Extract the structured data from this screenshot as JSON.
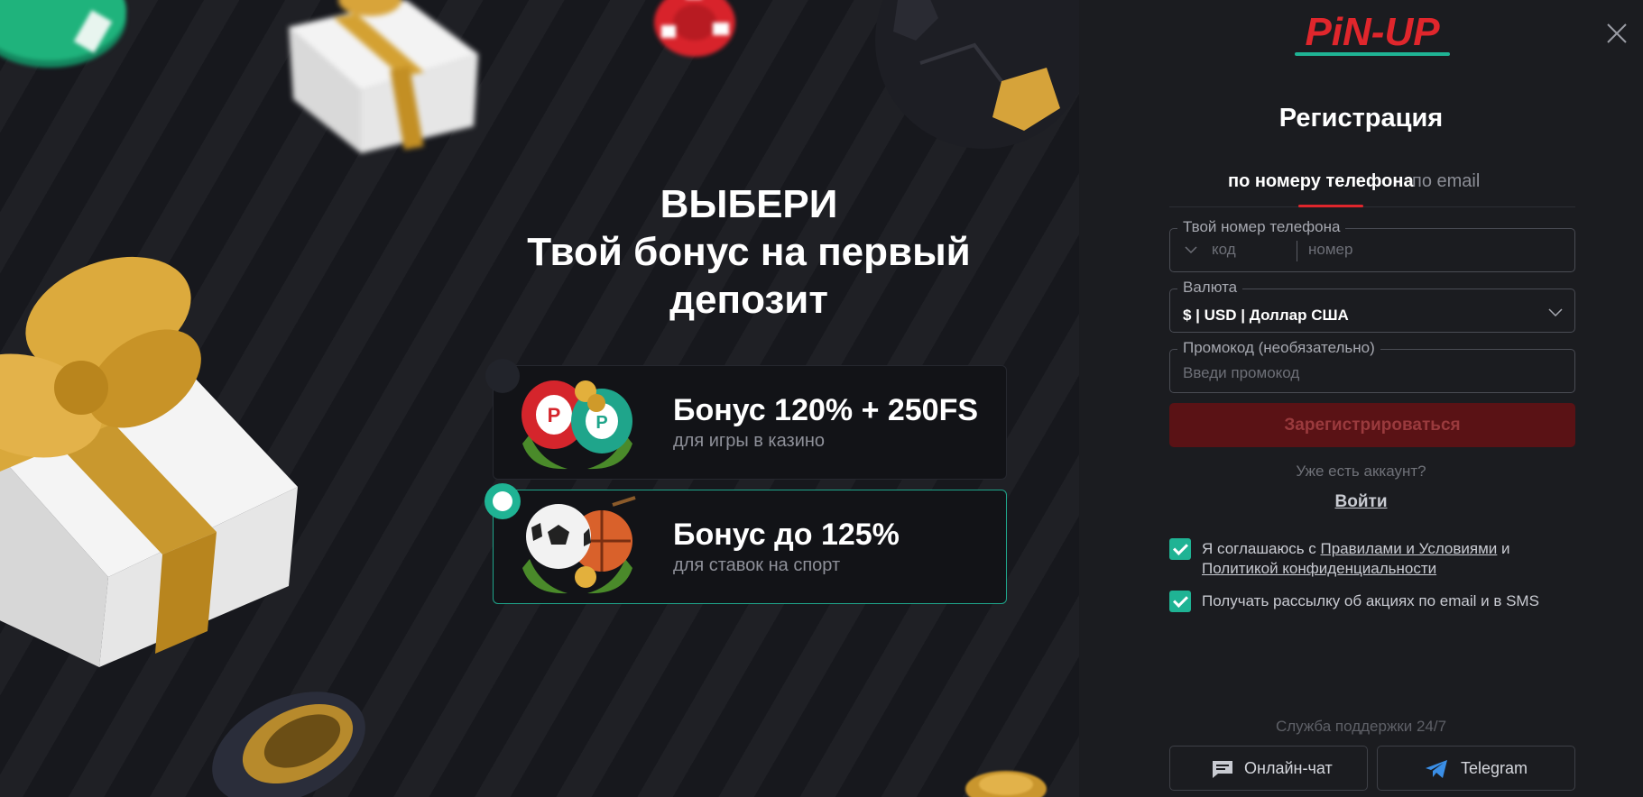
{
  "promo": {
    "title_line1": "ВЫБЕРИ",
    "title_line2": "Твой бонус на первый",
    "title_line3": "депозит",
    "bonuses": [
      {
        "title": "Бонус 120% + 250FS",
        "subtitle": "для игры в казино",
        "selected": false
      },
      {
        "title": "Бонус до 125%",
        "subtitle": "для ставок на спорт",
        "selected": true
      }
    ]
  },
  "panel": {
    "logo": "PiN-UP",
    "title": "Регистрация",
    "tabs": [
      {
        "label": "по номеру телефона",
        "active": true
      },
      {
        "label": "по email",
        "active": false
      }
    ],
    "phone": {
      "label": "Твой номер телефона",
      "code_placeholder": "код",
      "number_placeholder": "номер"
    },
    "currency": {
      "label": "Валюта",
      "value": "$ | USD | Доллар США"
    },
    "promocode": {
      "label": "Промокод (необязательно)",
      "placeholder": "Введи промокод"
    },
    "submit_label": "Зарегистрироваться",
    "have_account": "Уже есть аккаунт?",
    "login_label": "Войти",
    "agree": {
      "prefix": "Я соглашаюсь с ",
      "rules_link": "Правилами и Условиями",
      "and": " и ",
      "privacy_link": "Политикой конфиденциальности",
      "checked": true
    },
    "newsletter": {
      "label": "Получать рассылку об акциях по email и в SMS",
      "checked": true
    },
    "support_title": "Служба поддержки 24/7",
    "support_buttons": [
      {
        "label": "Онлайн-чат",
        "icon": "chat-icon"
      },
      {
        "label": "Telegram",
        "icon": "telegram-icon"
      }
    ]
  },
  "colors": {
    "accent_red": "#e0262c",
    "accent_teal": "#1fb394",
    "panel_bg": "#1b1c20",
    "promo_bg": "#17181d"
  }
}
